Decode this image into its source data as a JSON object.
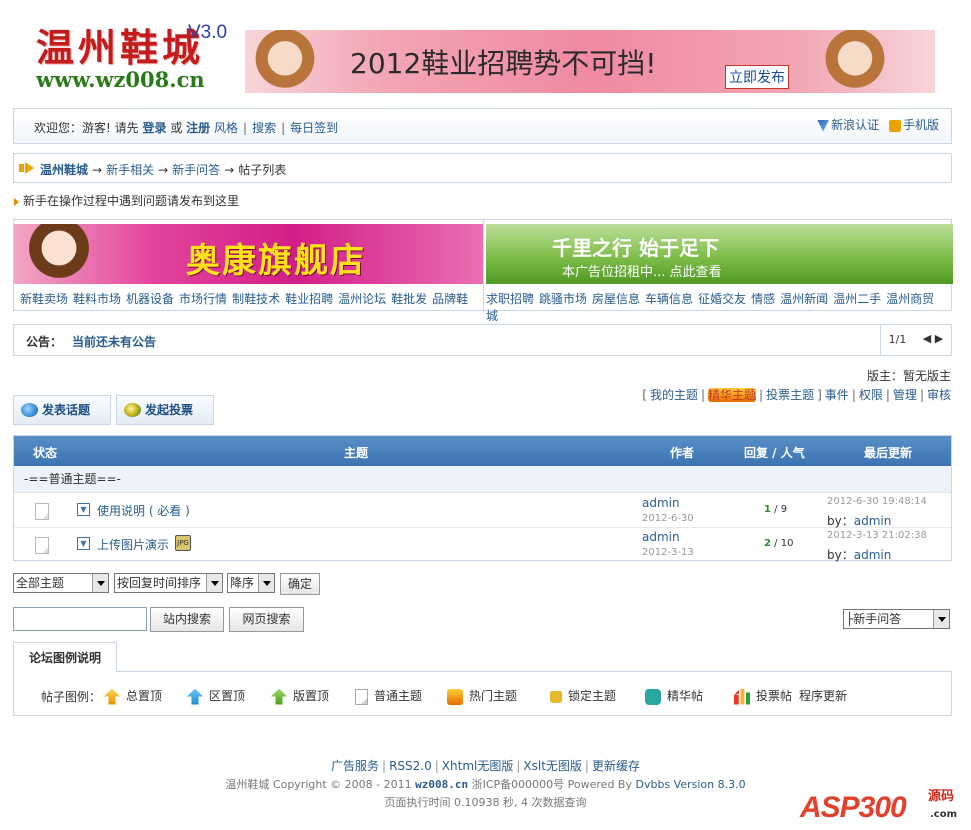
{
  "header": {
    "logo_cn": "温州鞋城",
    "logo_url": "www.wz008.cn",
    "version": "V3.0",
    "banner_text": "2012鞋业招聘势不可挡!",
    "banner_button": "立即发布"
  },
  "topnav": {
    "welcome": "欢迎您：游客! 请先",
    "login": "登录",
    "or": "或",
    "register": "注册",
    "style": "风格",
    "search": "搜索",
    "checkin": "每日签到",
    "weibo": "新浪认证",
    "mobile": "手机版"
  },
  "breadcrumb": {
    "home": "温州鞋城",
    "level1": "新手相关",
    "level2": "新手问答",
    "current": "帖子列表",
    "arrow": "→"
  },
  "forum_notice": "新手在操作过程中遇到问题请发布到这里",
  "ads": {
    "ad1_text": "奥康旗舰店",
    "ad2_line1": "千里之行 始于足下",
    "ad2_line2": "本广告位招租中...  点此查看",
    "links_left": [
      "新鞋卖场",
      "鞋料市场",
      "机器设备",
      "市场行情",
      "制鞋技术",
      "鞋业招聘",
      "温州论坛",
      "鞋批发",
      "品牌鞋"
    ],
    "links_right": [
      "求职招聘",
      "跳骚市场",
      "房屋信息",
      "车辆信息",
      "征婚交友",
      "情感",
      "温州新闻",
      "温州二手",
      "温州商贸城"
    ]
  },
  "announcement": {
    "label": "公告：",
    "text": "当前还未有公告",
    "page": "1/1",
    "prev": "◀",
    "next": "▶"
  },
  "moderator": "版主：暂无版主",
  "filters": {
    "my_topics": "我的主题",
    "digest": "精华主题",
    "polls": "投票主题",
    "events": "事件",
    "permissions": "权限",
    "manage": "管理",
    "audit": "审核"
  },
  "actions": {
    "post": "发表话题",
    "poll": "发起投票"
  },
  "table": {
    "headers": {
      "status": "状态",
      "subject": "主题",
      "author": "作者",
      "replies": "回复 / 人气",
      "last": "最后更新"
    },
    "section": "-==普通主题==-",
    "rows": [
      {
        "title": "使用说明 ( 必看 )",
        "author": "admin",
        "date": "2012-6-30",
        "replies": "1",
        "views": "/ 9",
        "last_time": "2012-6-30 19:48:14",
        "last_by_label": "by：",
        "last_by": "admin",
        "attachment": ""
      },
      {
        "title": "上传图片演示",
        "author": "admin",
        "date": "2012-3-13",
        "replies": "2",
        "views": "/ 10",
        "last_time": "2012-3-13 21:02:38",
        "last_by_label": "by：",
        "last_by": "admin",
        "attachment": "JPG"
      }
    ]
  },
  "controls": {
    "select_scope": "全部主题",
    "select_sort": "按回复时间排序",
    "select_order": "降序",
    "ok": "确定",
    "search_value": "",
    "site_search": "站内搜索",
    "web_search": "网页搜索",
    "jump": "├新手问答"
  },
  "legend": {
    "tab": "论坛图例说明",
    "label": "帖子图例：",
    "items": [
      "总置顶",
      "区置顶",
      "版置顶",
      "普通主题",
      "热门主题",
      "锁定主题",
      "精华帖",
      "投票帖",
      "程序更新"
    ]
  },
  "footer": {
    "links": [
      "广告服务",
      "RSS2.0",
      "Xhtml无图版",
      "Xslt无图版",
      "更新缓存"
    ],
    "site": "温州鞋城",
    "copyright": "Copyright © 2008 - 2011",
    "domain": "wz008.cn",
    "icp": "浙ICP备000000号",
    "powered_by": "Powered By",
    "powered_name": "Dvbbs Version 8.3.0",
    "exec": "页面执行时间 0.10938 秒, 4 次数据查询"
  },
  "watermark": {
    "brand": "ASP300",
    "source": "源码",
    "com": ".com"
  }
}
